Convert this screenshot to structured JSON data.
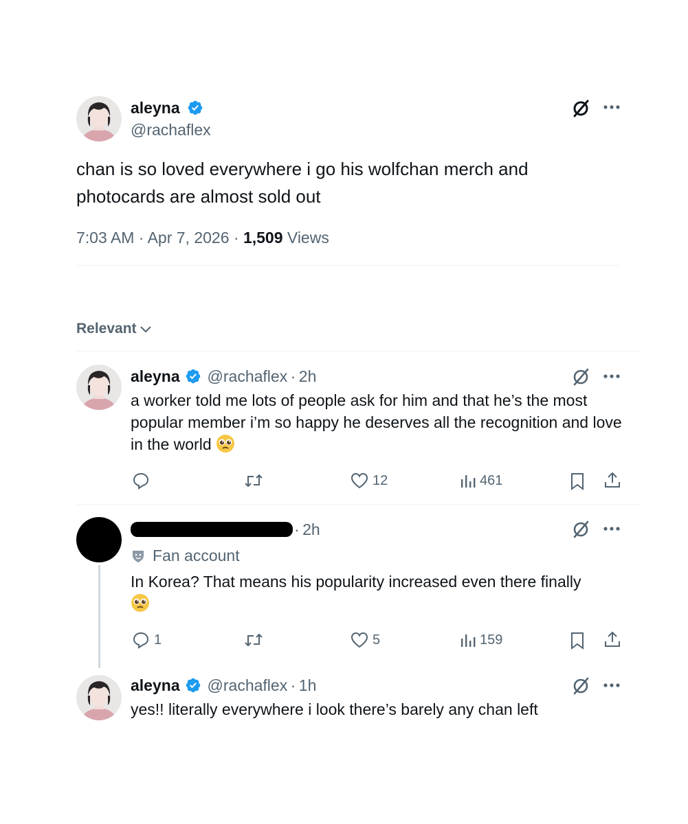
{
  "main_tweet": {
    "display_name": "aleyna",
    "handle": "@rachaflex",
    "text": "chan is so loved everywhere i go his wolfchan merch and photocards are almost sold out",
    "time": "7:03 AM",
    "date": "Apr 7, 2026",
    "views_count": "1,509",
    "views_label": "Views"
  },
  "sort": {
    "label": "Relevant"
  },
  "replies": [
    {
      "display_name": "aleyna",
      "handle": "@rachaflex",
      "time": "2h",
      "text": "a worker told me lots of people ask for him and that he’s the most popular member i’m so happy he deserves all the recognition and love in the world",
      "comments": "",
      "retweets": "",
      "likes": "12",
      "views": "461"
    },
    {
      "time": "2h",
      "account_label": "Fan account",
      "text": "In Korea? That means his popularity increased even there finally",
      "comments": "1",
      "retweets": "",
      "likes": "5",
      "views": "159"
    },
    {
      "display_name": "aleyna",
      "handle": "@rachaflex",
      "time": "1h",
      "text": "yes!! literally everywhere i look there’s barely any chan left"
    }
  ],
  "colors": {
    "verified": "#1d9bf0",
    "muted": "#536471",
    "text": "#0f1419",
    "divider": "#eff3f4"
  },
  "icons": [
    "verified-badge-icon",
    "grok-icon",
    "more-icon",
    "reply-icon",
    "retweet-icon",
    "like-icon",
    "views-icon",
    "bookmark-icon",
    "share-icon",
    "chevron-down-icon",
    "fan-account-icon",
    "pleading-face-emoji"
  ]
}
